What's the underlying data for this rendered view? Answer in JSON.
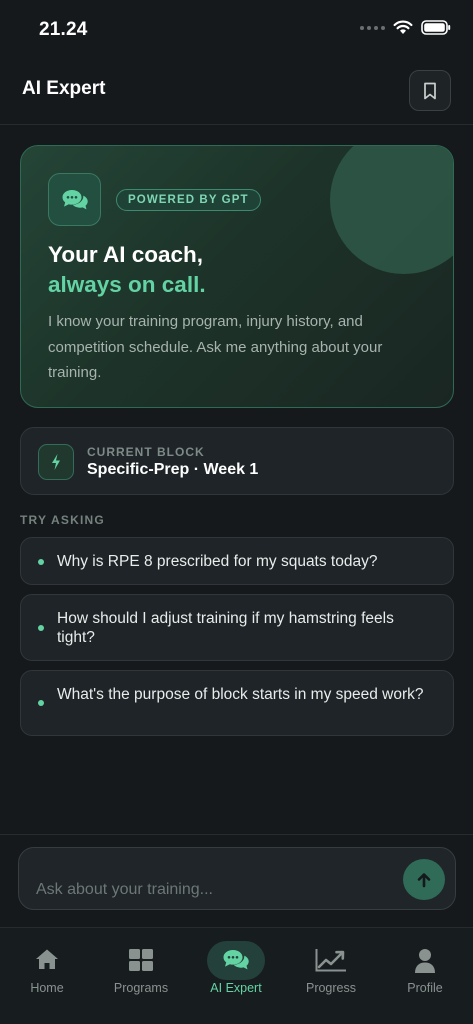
{
  "status_bar": {
    "time": "21.24"
  },
  "header": {
    "title": "AI Expert",
    "bookmark_icon": "bookmark-icon"
  },
  "hero": {
    "badge": "POWERED BY GPT",
    "title": "Your AI coach,",
    "title_accent": "always on call.",
    "description": "I know your training program, injury history, and competition schedule. Ask me anything about your training.",
    "icon": "chat-bubbles-icon"
  },
  "current_block": {
    "label": "CURRENT BLOCK",
    "value": "Specific-Prep · Week 1",
    "icon": "lightning-icon"
  },
  "try_asking": {
    "label": "TRY ASKING",
    "items": [
      "Why is RPE 8 prescribed for my squats today?",
      "How should I adjust training if my hamstring feels tight?",
      "What's the purpose of block starts in my speed work?"
    ]
  },
  "composer": {
    "placeholder": "Ask about your training...",
    "send_icon": "arrow-up-icon"
  },
  "tab_bar": {
    "active": "AI Expert",
    "tabs": [
      {
        "label": "Home",
        "icon": "home-icon"
      },
      {
        "label": "Programs",
        "icon": "grid-icon"
      },
      {
        "label": "AI Expert",
        "icon": "chat-bubbles-icon"
      },
      {
        "label": "Progress",
        "icon": "chart-line-icon"
      },
      {
        "label": "Profile",
        "icon": "person-icon"
      }
    ]
  },
  "colors": {
    "background": "#15191c",
    "accent": "#63d3a3",
    "card": "#1e2427",
    "hero_border": "#2f6a55"
  }
}
